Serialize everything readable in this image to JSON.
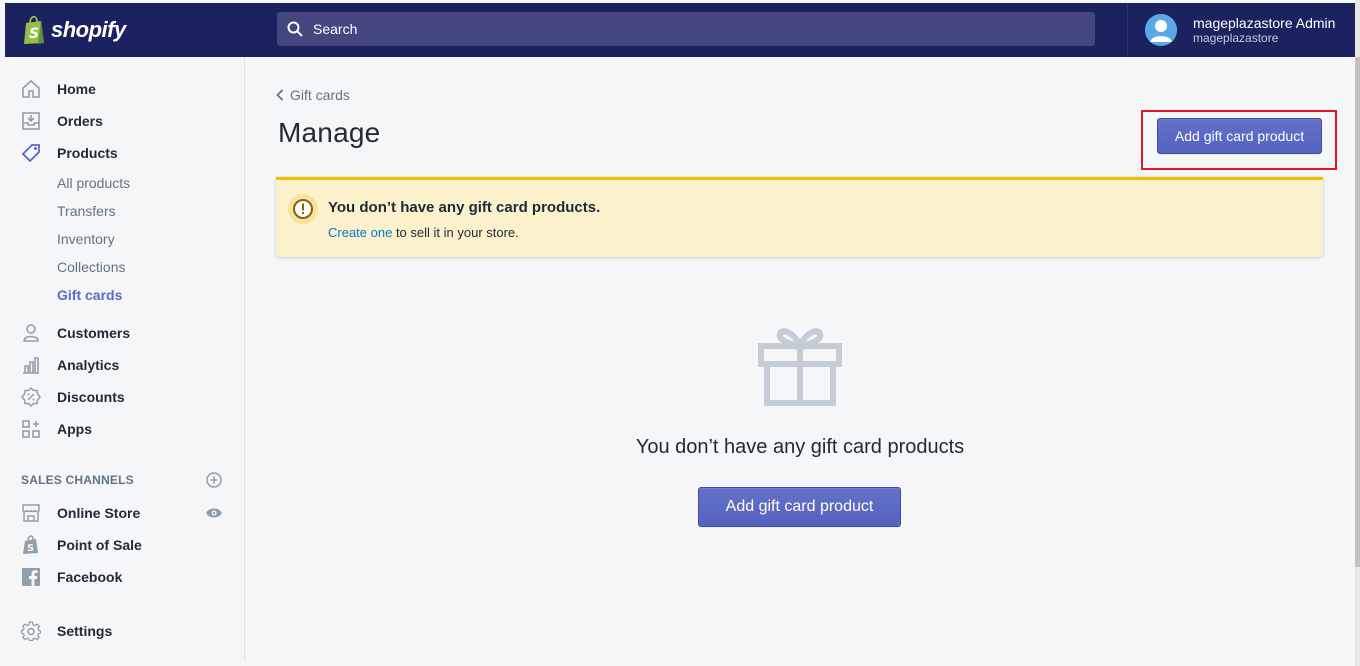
{
  "app": {
    "brand": "shopify"
  },
  "search": {
    "placeholder": "Search"
  },
  "account": {
    "name": "mageplazastore Admin",
    "store": "mageplazastore"
  },
  "sidebar": {
    "items": [
      {
        "label": "Home",
        "icon": "home-icon"
      },
      {
        "label": "Orders",
        "icon": "orders-icon"
      },
      {
        "label": "Products",
        "icon": "tag-icon"
      }
    ],
    "product_sub_items": [
      {
        "label": "All products"
      },
      {
        "label": "Transfers"
      },
      {
        "label": "Inventory"
      },
      {
        "label": "Collections"
      },
      {
        "label": "Gift cards",
        "active": true
      }
    ],
    "items_after": [
      {
        "label": "Customers",
        "icon": "person-icon"
      },
      {
        "label": "Analytics",
        "icon": "bar-chart-icon"
      },
      {
        "label": "Discounts",
        "icon": "discount-icon"
      },
      {
        "label": "Apps",
        "icon": "apps-icon"
      }
    ],
    "sales_channels_title": "SALES CHANNELS",
    "channels": [
      {
        "label": "Online Store",
        "icon": "storefront-icon"
      },
      {
        "label": "Point of Sale",
        "icon": "shopping-bag-icon"
      },
      {
        "label": "Facebook",
        "icon": "facebook-icon"
      }
    ],
    "settings_label": "Settings"
  },
  "main": {
    "breadcrumb": "Gift cards",
    "title": "Manage",
    "add_button": "Add gift card product",
    "banner": {
      "title": "You don’t have any gift card products.",
      "link": "Create one",
      "text": " to sell it in your store."
    },
    "empty_state": {
      "title": "You don’t have any gift card products",
      "button": "Add gift card product"
    }
  },
  "colors": {
    "topbar": "#1c2260",
    "primary": "#5c6ac4",
    "banner": "#fcf1cd",
    "highlight": "#e0171f"
  }
}
